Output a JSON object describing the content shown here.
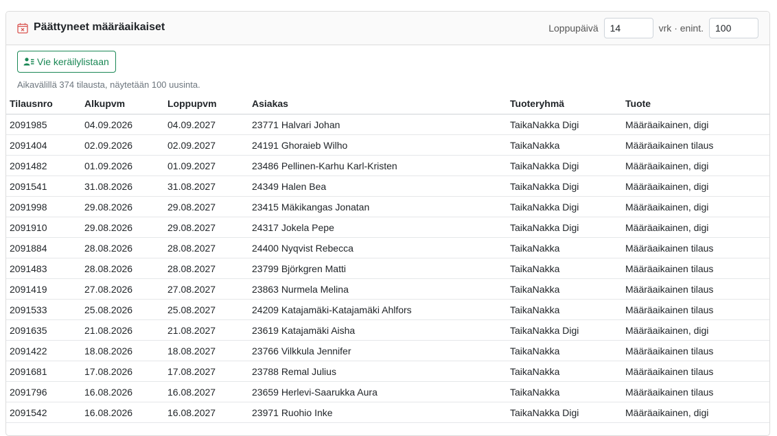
{
  "header": {
    "title": "Päättyneet määräaikaiset",
    "end_day_label": "Loppupäivä",
    "end_day_value": "14",
    "unit_label": "vrk · enint.",
    "max_value": "100"
  },
  "toolbar": {
    "export_label": "Vie keräilylistaan"
  },
  "info_text": "Aikavälillä 374 tilausta, näytetään 100 uusinta.",
  "table": {
    "columns": [
      "Tilausnro",
      "Alkupvm",
      "Loppupvm",
      "Asiakas",
      "Tuoteryhmä",
      "Tuote"
    ],
    "rows": [
      [
        "2091985",
        "04.09.2026",
        "04.09.2027",
        "23771 Halvari Johan",
        "TaikaNakka Digi",
        "Määräaikainen, digi"
      ],
      [
        "2091404",
        "02.09.2026",
        "02.09.2027",
        "24191 Ghoraieb Wilho",
        "TaikaNakka",
        "Määräaikainen tilaus"
      ],
      [
        "2091482",
        "01.09.2026",
        "01.09.2027",
        "23486 Pellinen-Karhu Karl-Kristen",
        "TaikaNakka Digi",
        "Määräaikainen, digi"
      ],
      [
        "2091541",
        "31.08.2026",
        "31.08.2027",
        "24349 Halen Bea",
        "TaikaNakka Digi",
        "Määräaikainen, digi"
      ],
      [
        "2091998",
        "29.08.2026",
        "29.08.2027",
        "23415 Mäkikangas Jonatan",
        "TaikaNakka Digi",
        "Määräaikainen, digi"
      ],
      [
        "2091910",
        "29.08.2026",
        "29.08.2027",
        "24317 Jokela Pepe",
        "TaikaNakka Digi",
        "Määräaikainen, digi"
      ],
      [
        "2091884",
        "28.08.2026",
        "28.08.2027",
        "24400 Nyqvist Rebecca",
        "TaikaNakka",
        "Määräaikainen tilaus"
      ],
      [
        "2091483",
        "28.08.2026",
        "28.08.2027",
        "23799 Björkgren Matti",
        "TaikaNakka",
        "Määräaikainen tilaus"
      ],
      [
        "2091419",
        "27.08.2026",
        "27.08.2027",
        "23863 Nurmela Melina",
        "TaikaNakka",
        "Määräaikainen tilaus"
      ],
      [
        "2091533",
        "25.08.2026",
        "25.08.2027",
        "24209 Katajamäki-Katajamäki Ahlfors",
        "TaikaNakka",
        "Määräaikainen tilaus"
      ],
      [
        "2091635",
        "21.08.2026",
        "21.08.2027",
        "23619 Katajamäki Aisha",
        "TaikaNakka Digi",
        "Määräaikainen, digi"
      ],
      [
        "2091422",
        "18.08.2026",
        "18.08.2027",
        "23766 Vilkkula Jennifer",
        "TaikaNakka",
        "Määräaikainen tilaus"
      ],
      [
        "2091681",
        "17.08.2026",
        "17.08.2027",
        "23788 Remal Julius",
        "TaikaNakka",
        "Määräaikainen tilaus"
      ],
      [
        "2091796",
        "16.08.2026",
        "16.08.2027",
        "23659 Herlevi-Saarukka Aura",
        "TaikaNakka",
        "Määräaikainen tilaus"
      ],
      [
        "2091542",
        "16.08.2026",
        "16.08.2027",
        "23971 Ruohio Inke",
        "TaikaNakka Digi",
        "Määräaikainen, digi"
      ]
    ]
  },
  "colors": {
    "accent_red": "#d9534f",
    "button_green": "#198754"
  }
}
